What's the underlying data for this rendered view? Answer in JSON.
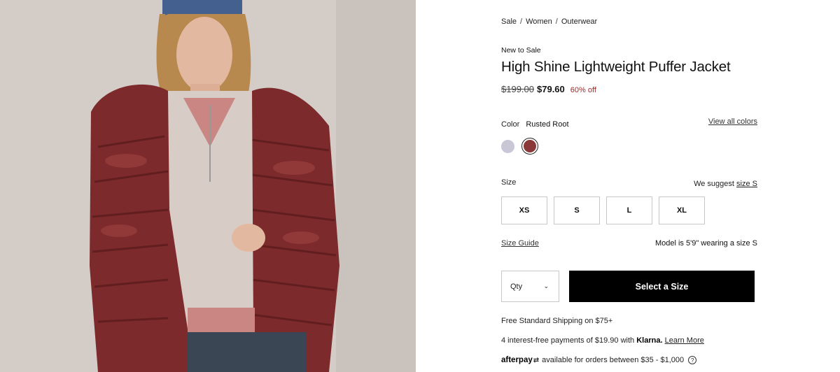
{
  "product_image": {
    "alt_icon": "product-photo"
  },
  "breadcrumb": {
    "items": [
      "Sale",
      "Women",
      "Outerwear"
    ],
    "separator": "/"
  },
  "product": {
    "badge": "New to Sale",
    "title": "High Shine Lightweight Puffer Jacket",
    "price_original": "$199.00",
    "price_sale": "$79.60",
    "discount": "60% off"
  },
  "color": {
    "label": "Color",
    "selected": "Rusted Root",
    "view_all": "View all colors",
    "swatches": [
      {
        "name": "lavender",
        "hex": "#c9c6d6"
      },
      {
        "name": "rusted-root",
        "hex": "#8b3838"
      }
    ]
  },
  "size": {
    "label": "Size",
    "suggest_prefix": "We suggest",
    "suggest_link": "size S",
    "options": [
      "XS",
      "S",
      "L",
      "XL"
    ],
    "guide": "Size Guide",
    "model_note": "Model is 5'9\" wearing a size S"
  },
  "purchase": {
    "qty_label": "Qty",
    "qty_icon": "chevron-down-icon",
    "add_button": "Select a Size"
  },
  "info": {
    "shipping": "Free Standard Shipping on $75+",
    "klarna_prefix": "4 interest-free payments of $19.90 with",
    "klarna_brand": "Klarna.",
    "klarna_link": "Learn More",
    "afterpay_brand": "afterpay",
    "afterpay_text": "available for orders between $35 - $1,000"
  },
  "colors": {
    "accent_discount": "#a12b2b",
    "cta_bg": "#000000"
  }
}
